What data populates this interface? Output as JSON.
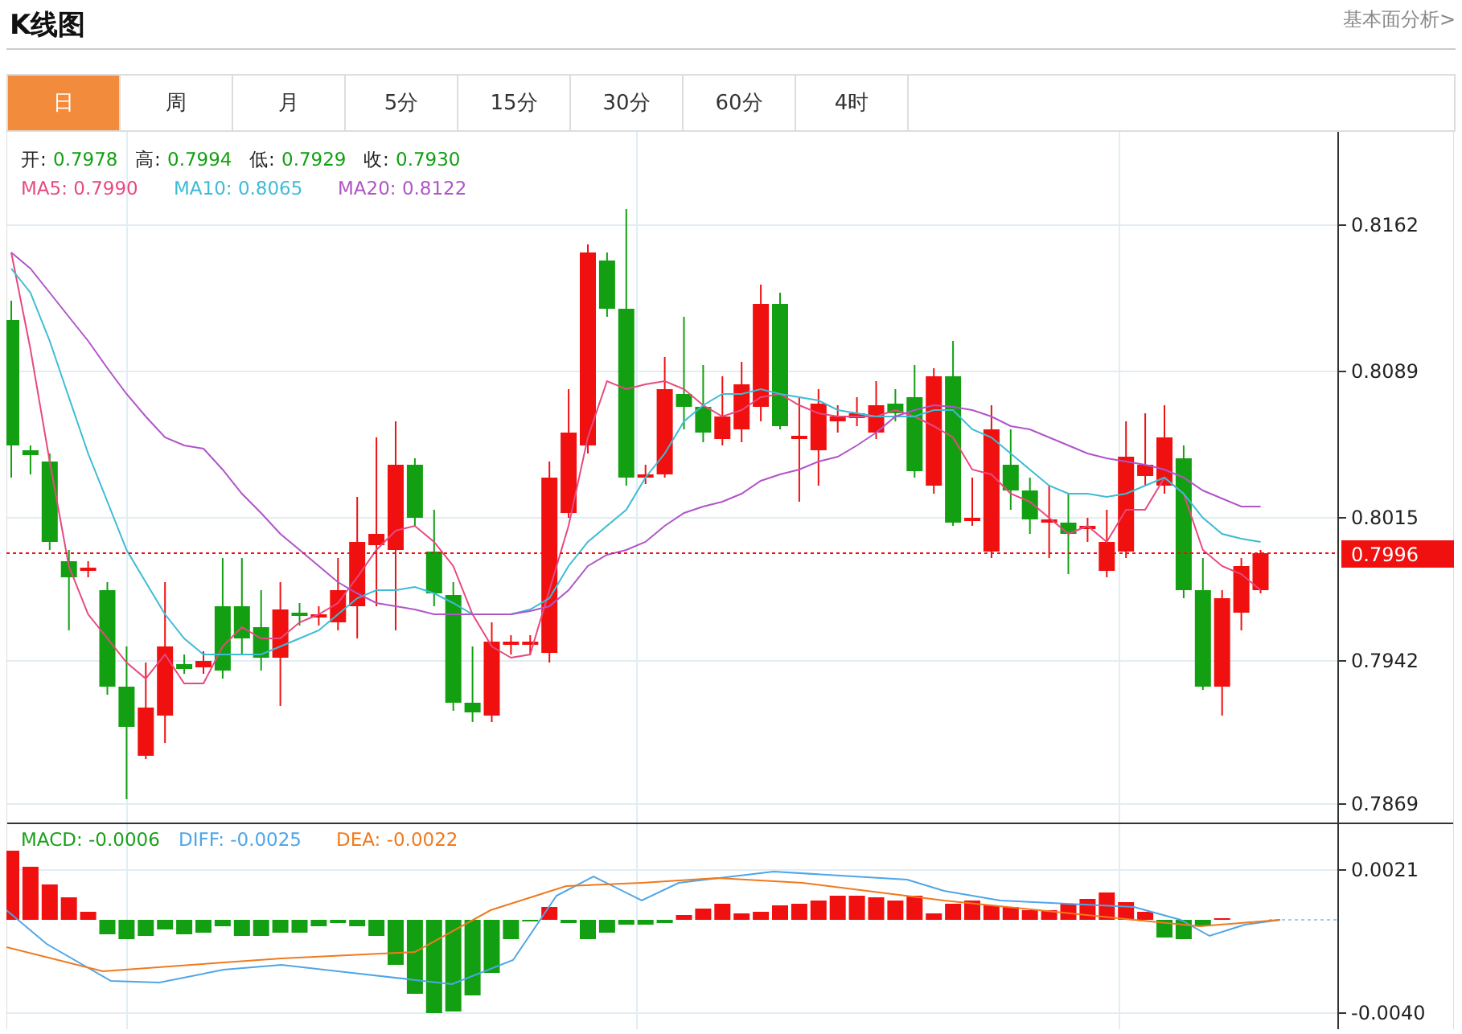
{
  "header": {
    "title": "K线图",
    "link": "基本面分析>"
  },
  "tabs": [
    {
      "label": "日",
      "selected": true
    },
    {
      "label": "周",
      "selected": false
    },
    {
      "label": "月",
      "selected": false
    },
    {
      "label": "5分",
      "selected": false
    },
    {
      "label": "15分",
      "selected": false
    },
    {
      "label": "30分",
      "selected": false
    },
    {
      "label": "60分",
      "selected": false
    },
    {
      "label": "4时",
      "selected": false
    }
  ],
  "quote": [
    {
      "label": "开:",
      "value": "0.7978"
    },
    {
      "label": "高:",
      "value": "0.7994"
    },
    {
      "label": "低:",
      "value": "0.7929"
    },
    {
      "label": "收:",
      "value": "0.7930"
    }
  ],
  "moving_averages": [
    {
      "label": "MA5: 0.7990",
      "color": "#e8497f"
    },
    {
      "label": "MA10: 0.8065",
      "color": "#3dbcd4"
    },
    {
      "label": "MA20: 0.8122",
      "color": "#b055c8"
    }
  ],
  "price_axis": [
    "0.8162",
    "0.8089",
    "0.8015",
    "0.7942",
    "0.7869"
  ],
  "current_price": "0.7996",
  "macd_legend": [
    {
      "label": "MACD: -0.0006",
      "color": "#1aa01a"
    },
    {
      "label": "DIFF: -0.0025",
      "color": "#4ea6e8"
    },
    {
      "label": "DEA: -0.0022",
      "color": "#f07a1e"
    }
  ],
  "macd_axis": [
    "0.0021",
    "-0.0040"
  ]
}
